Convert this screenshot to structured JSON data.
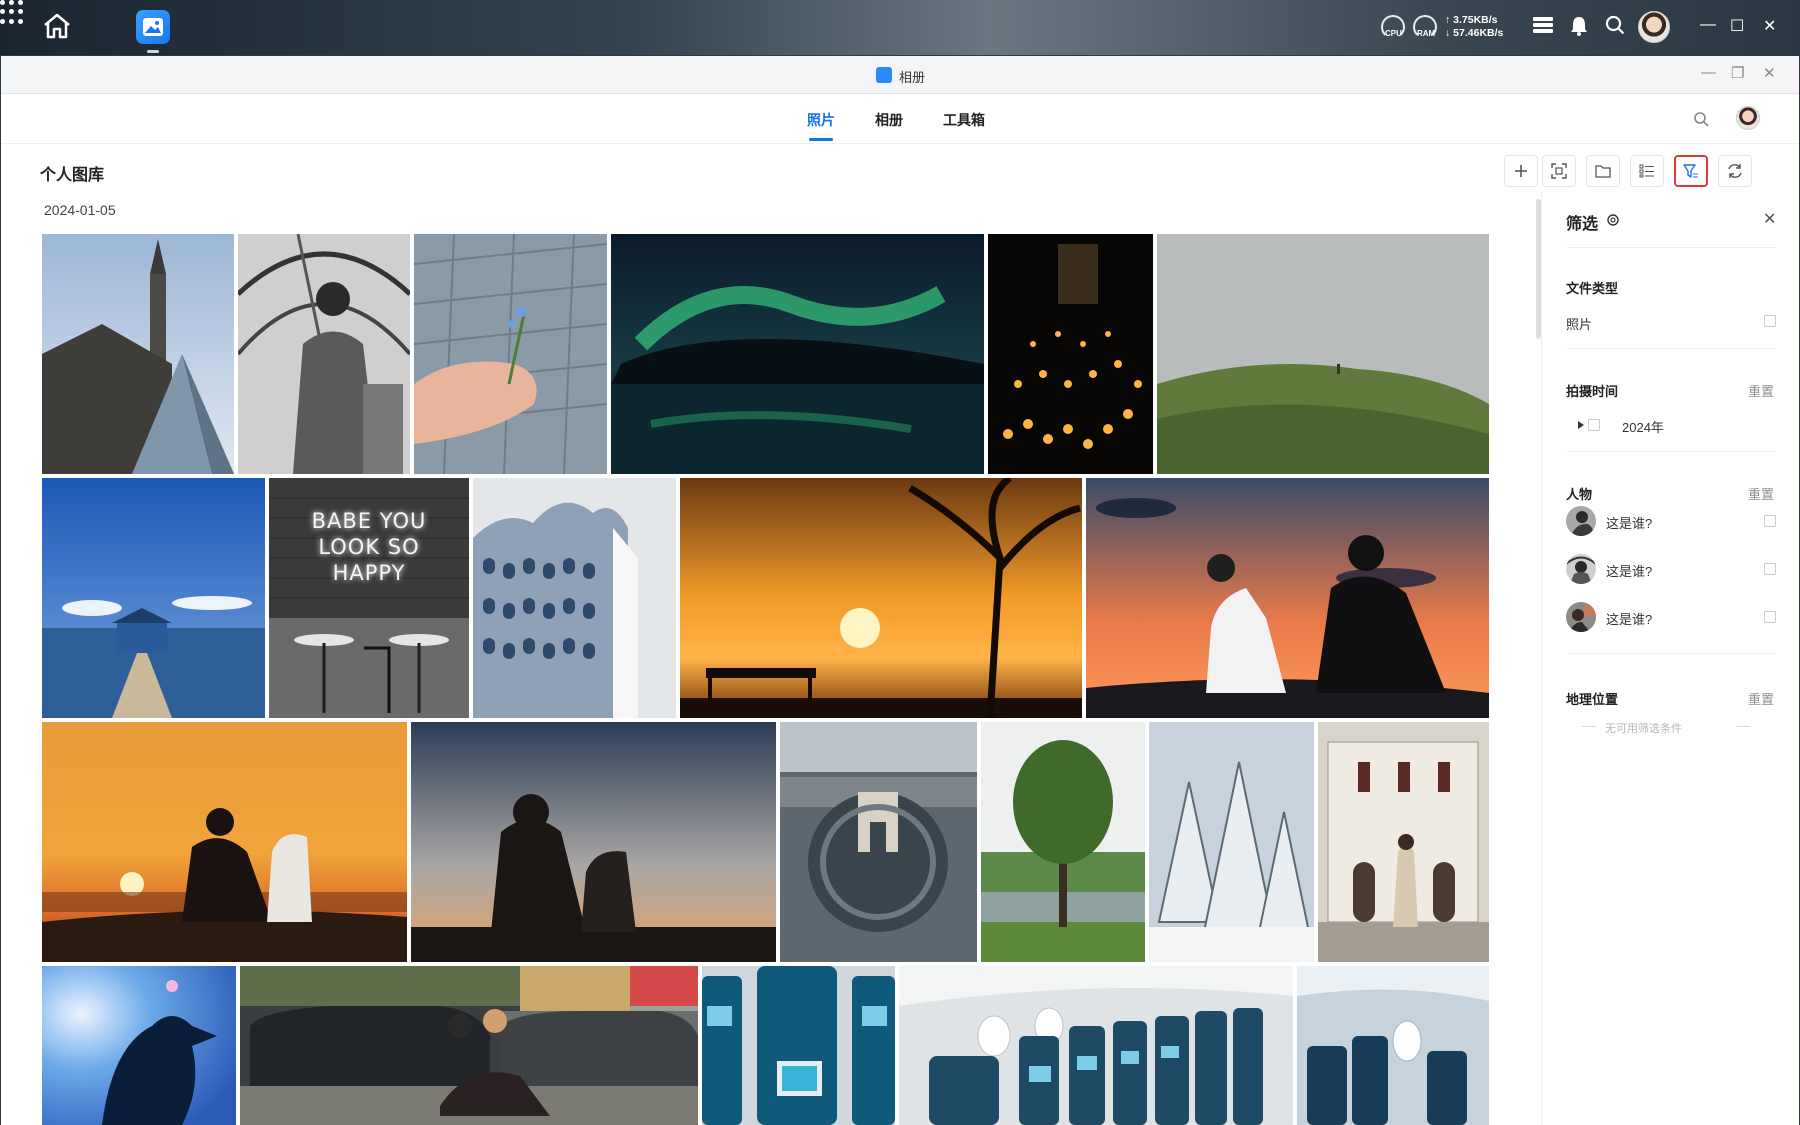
{
  "os": {
    "cpu_label": "CPU",
    "ram_label": "RAM",
    "net_up": "↑ 3.75KB/s",
    "net_down": "↓ 57.46KB/s"
  },
  "window": {
    "title": "相册"
  },
  "nav": {
    "tabs": [
      "照片",
      "相册",
      "工具箱"
    ],
    "active_tab": "照片"
  },
  "library": {
    "title": "个人图库",
    "date": "2024-01-05"
  },
  "filter": {
    "title": "筛选",
    "file_type": {
      "label": "文件类型",
      "option": "照片"
    },
    "shot_time": {
      "label": "拍摄时间",
      "reset": "重置",
      "year": "2024年"
    },
    "people": {
      "label": "人物",
      "reset": "重置",
      "faces": [
        "这是谁?",
        "这是谁?",
        "这是谁?"
      ]
    },
    "location": {
      "label": "地理位置",
      "reset": "重置",
      "empty": "无可用筛选条件"
    }
  },
  "photos": {
    "neon_sign": [
      "BABE YOU",
      "LOOK SO",
      "HAPPY"
    ]
  },
  "colors": {
    "accent": "#1a73e8",
    "highlight": "#e53935"
  }
}
